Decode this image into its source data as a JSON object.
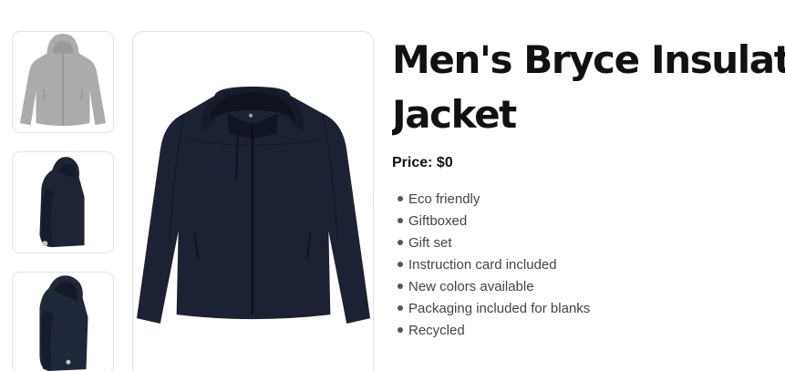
{
  "gallery": {
    "thumbnails": [
      {
        "name": "front view, grey",
        "color": "#a9a9a9"
      },
      {
        "name": "side view, navy",
        "color": "#1d2436"
      },
      {
        "name": "side view with hood, navy",
        "color": "#1d2436"
      }
    ],
    "main_image": {
      "name": "front view, navy",
      "color": "#1c2233"
    }
  },
  "product": {
    "title_line1": "Men's Bryce Insulated",
    "title_line2": "Jacket",
    "price_label": "Price: $0",
    "features": [
      "Eco friendly",
      "Giftboxed",
      "Gift set",
      "Instruction card included",
      "New colors available",
      "Packaging included for blanks",
      "Recycled"
    ]
  }
}
